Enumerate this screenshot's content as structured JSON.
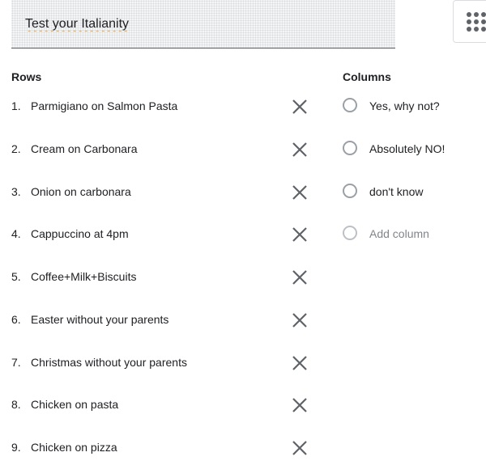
{
  "question": {
    "title": "Test your Italianity"
  },
  "type_dropdown": {
    "icon": "grid-icon"
  },
  "rows_section": {
    "label": "Rows",
    "items": [
      {
        "num": "1.",
        "text": "Parmigiano on Salmon Pasta"
      },
      {
        "num": "2.",
        "text": "Cream on Carbonara"
      },
      {
        "num": "3.",
        "text": "Onion on carbonara"
      },
      {
        "num": "4.",
        "text": "Cappuccino at 4pm"
      },
      {
        "num": "5.",
        "text": "Coffee+Milk+Biscuits"
      },
      {
        "num": "6.",
        "text": "Easter without your parents"
      },
      {
        "num": "7.",
        "text": "Christmas without your parents"
      },
      {
        "num": "8.",
        "text": "Chicken on pasta"
      },
      {
        "num": "9.",
        "text": "Chicken on pizza"
      }
    ],
    "remove_icon": "close-icon"
  },
  "columns_section": {
    "label": "Columns",
    "items": [
      {
        "text": "Yes, why not?"
      },
      {
        "text": "Absolutely NO!"
      },
      {
        "text": "don't know"
      }
    ],
    "add_label": "Add column"
  },
  "colors": {
    "text": "#202124",
    "muted": "#80868b",
    "icon": "#5f6368",
    "radio": "#9aa0a6",
    "spellcheck_underline": "#e8a33d"
  }
}
